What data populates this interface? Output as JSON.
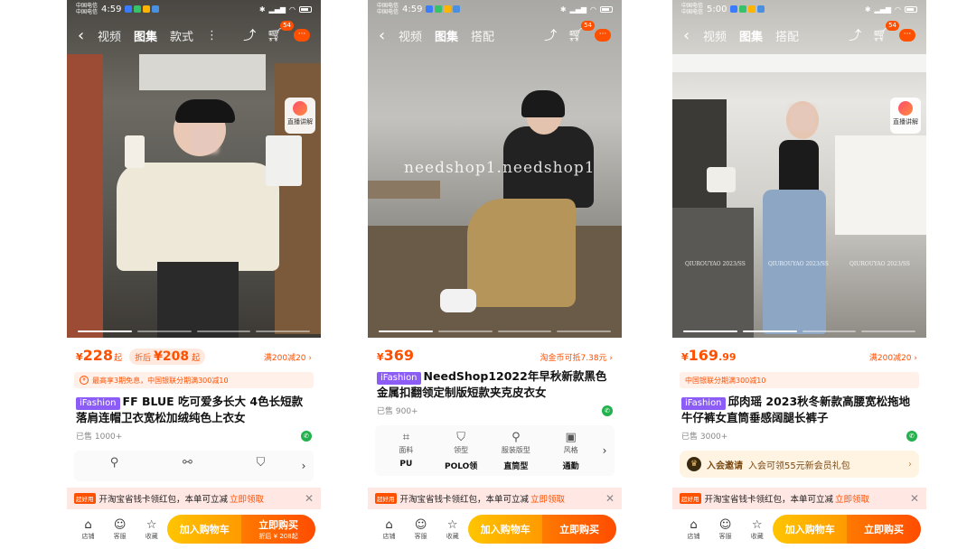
{
  "screens": [
    {
      "status": {
        "carrier": "中国电信\n中国电信",
        "time": "4:59"
      },
      "nav": {
        "tabs": [
          "视频",
          "图集",
          "款式"
        ],
        "cart_count": "54"
      },
      "live_label": "直播讲解",
      "price": {
        "currency": "¥",
        "value": "228",
        "suffix": "起",
        "discount_label": "折后",
        "discount_value": "¥208",
        "discount_suffix": "起",
        "right": "满200减20 ›"
      },
      "promo": "最高享3期免息，中国银联分期满300减10",
      "brand_tag": "iFashion",
      "title": "FF BLUE 吃可爱多长大 4色长短款落肩连帽卫衣宽松加绒纯色上衣女",
      "sold": "已售 1000+",
      "coupon": {
        "tag": "超好用",
        "text": "开淘宝省钱卡领红包，本单可立减",
        "link": "立即领取"
      },
      "bottom": {
        "shop": "店铺",
        "service": "客服",
        "fav": "收藏",
        "add_cart": "加入购物车",
        "buy": "立即购买",
        "buy_sub": "折后 ¥ 208起"
      }
    },
    {
      "status": {
        "carrier": "中国电信\n中国电信",
        "time": "4:59"
      },
      "nav": {
        "tabs": [
          "视频",
          "图集",
          "搭配"
        ],
        "cart_count": "54"
      },
      "watermark": "needshop1.needshop1",
      "price": {
        "currency": "¥",
        "value": "369",
        "right": "淘金币可抵7.38元 ›"
      },
      "brand_tag": "iFashion",
      "title": "NeedShop12022年早秋新款黑色金属扣翻领定制版短款夹克皮衣女",
      "sold": "已售 900+",
      "attrs": [
        {
          "label": "面料",
          "value": "PU"
        },
        {
          "label": "领型",
          "value": "POLO领"
        },
        {
          "label": "服装版型",
          "value": "直筒型"
        },
        {
          "label": "风格",
          "value": "通勤"
        }
      ],
      "coupon": {
        "tag": "超好用",
        "text": "开淘宝省钱卡领红包，本单可立减",
        "link": "立即领取"
      },
      "bottom": {
        "shop": "店铺",
        "service": "客服",
        "fav": "收藏",
        "add_cart": "加入购物车",
        "buy": "立即购买"
      }
    },
    {
      "status": {
        "carrier": "中国电信\n中国电信",
        "time": "5:00"
      },
      "nav": {
        "tabs": [
          "视频",
          "图集",
          "搭配"
        ],
        "cart_count": "54"
      },
      "live_label": "直播讲解",
      "wm_small": [
        "QIUROUYAO 2023/SS",
        "QIUROUYAO 2023/SS",
        "QIUROUYAO 2023/SS"
      ],
      "price": {
        "currency": "¥",
        "value": "169",
        "decimals": ".99",
        "right": "满200减20 ›"
      },
      "promo": "中国银联分期满300减10",
      "brand_tag": "iFashion",
      "title": "邱肉瑶 2023秋冬新款高腰宽松拖地牛仔裤女直筒垂感阔腿长裤子",
      "sold": "已售 3000+",
      "member": {
        "bold": "入会邀请",
        "text": "入会可领55元新会员礼包"
      },
      "coupon": {
        "tag": "超好用",
        "text": "开淘宝省钱卡领红包，本单可立减",
        "link": "立即领取"
      },
      "bottom": {
        "shop": "店铺",
        "service": "客服",
        "fav": "收藏",
        "add_cart": "加入购物车",
        "buy": "立即购买"
      }
    }
  ],
  "colors": {
    "accent": "#ff5000",
    "brand_tag": "#8b5cf6",
    "add_cart": "#ffb000",
    "buy": "#ff5a00"
  }
}
